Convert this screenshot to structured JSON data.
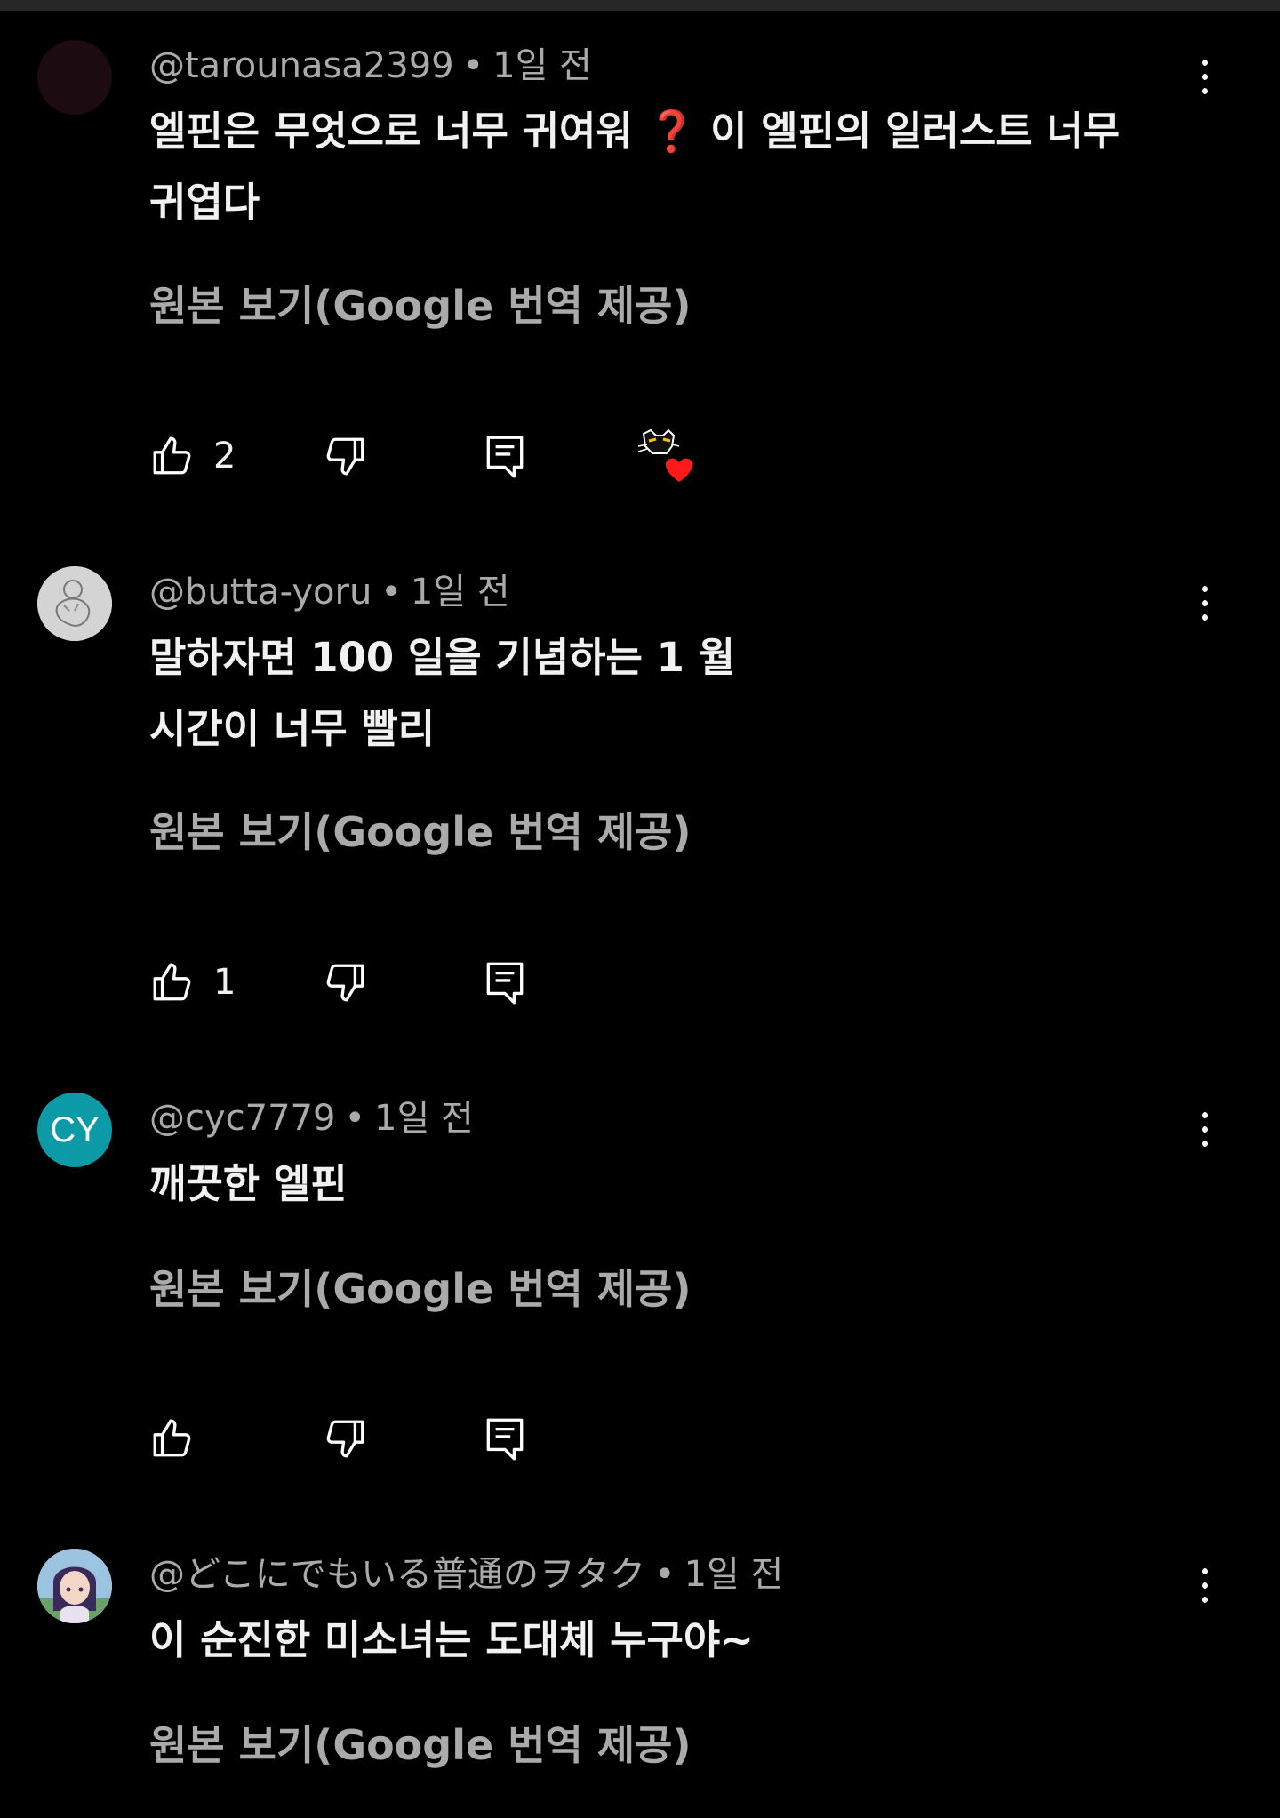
{
  "comments": [
    {
      "author": "@tarounasa2399",
      "time": "1일 전",
      "text_line1": "엘핀은 무엇으로 너무 귀여워 ❓ 이 엘핀의 일러스트 너무",
      "text_line2": "귀엽다",
      "translate_label": "원본 보기(Google 번역 제공)",
      "likes": "2",
      "creator_heart": true,
      "avatar_color": "#1c0c12"
    },
    {
      "author": "@butta-yoru",
      "time": "1일 전",
      "text_line1": "말하자면 100 일을 기념하는 1 월",
      "text_line2": "시간이 너무 빨리",
      "translate_label": "원본 보기(Google 번역 제공)",
      "likes": "1",
      "avatar_color": "#cfcfcf"
    },
    {
      "author": "@cyc7779",
      "time": "1일 전",
      "text_line1": "깨끗한 엘핀",
      "translate_label": "원본 보기(Google 번역 제공)",
      "likes": "",
      "avatar_initials": "CY",
      "avatar_color": "#0b9aa6"
    },
    {
      "author": "@どこにでもいる普通のヲタク",
      "time": "1일 전",
      "text_line1": "이 순진한 미소녀는 도대체 누구야~",
      "translate_label": "원본 보기(Google 번역 제공)",
      "avatar_color": "#7a6e8a"
    }
  ],
  "meta_separator": "•",
  "icons": {
    "like": "thumb-up-icon",
    "dislike": "thumb-down-icon",
    "reply": "reply-icon",
    "more": "more-vertical-icon",
    "heart": "creator-heart-icon"
  },
  "colors": {
    "background": "#000000",
    "primary_text": "#f1f1f1",
    "secondary_text": "#aaaaaa",
    "heart": "#ff1a1a"
  }
}
